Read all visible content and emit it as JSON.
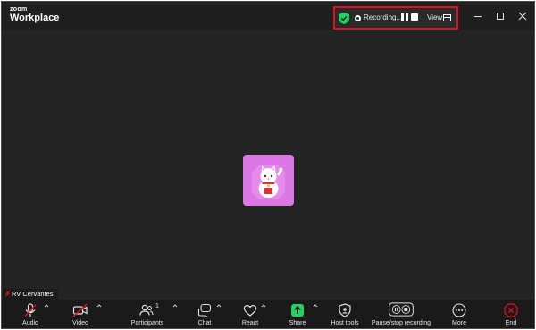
{
  "app": {
    "brand_small": "zoom",
    "brand_big": "Workplace"
  },
  "recording": {
    "status": "Recording...",
    "view_label": "View"
  },
  "participant": {
    "name": "RV Cervantes"
  },
  "toolbar": {
    "audio": "Audio",
    "video": "Video",
    "participants": "Participants",
    "participants_count": "1",
    "chat": "Chat",
    "react": "React",
    "share": "Share",
    "host_tools": "Host tools",
    "pause_stop": "Pause/stop recording",
    "more": "More",
    "end": "End"
  },
  "colors": {
    "accent_green": "#23d160",
    "record_highlight": "#e0101e",
    "muted_red": "#e0101e",
    "avatar_bg": "#dc77e6"
  },
  "icons": [
    "shield-icon",
    "record-icon",
    "pause-icon",
    "stop-icon",
    "gallery-view-icon",
    "mic-muted-icon",
    "video-off-icon",
    "participants-icon",
    "chat-icon",
    "heart-icon",
    "share-arrow-icon",
    "host-shield-icon",
    "more-icon",
    "end-icon"
  ]
}
